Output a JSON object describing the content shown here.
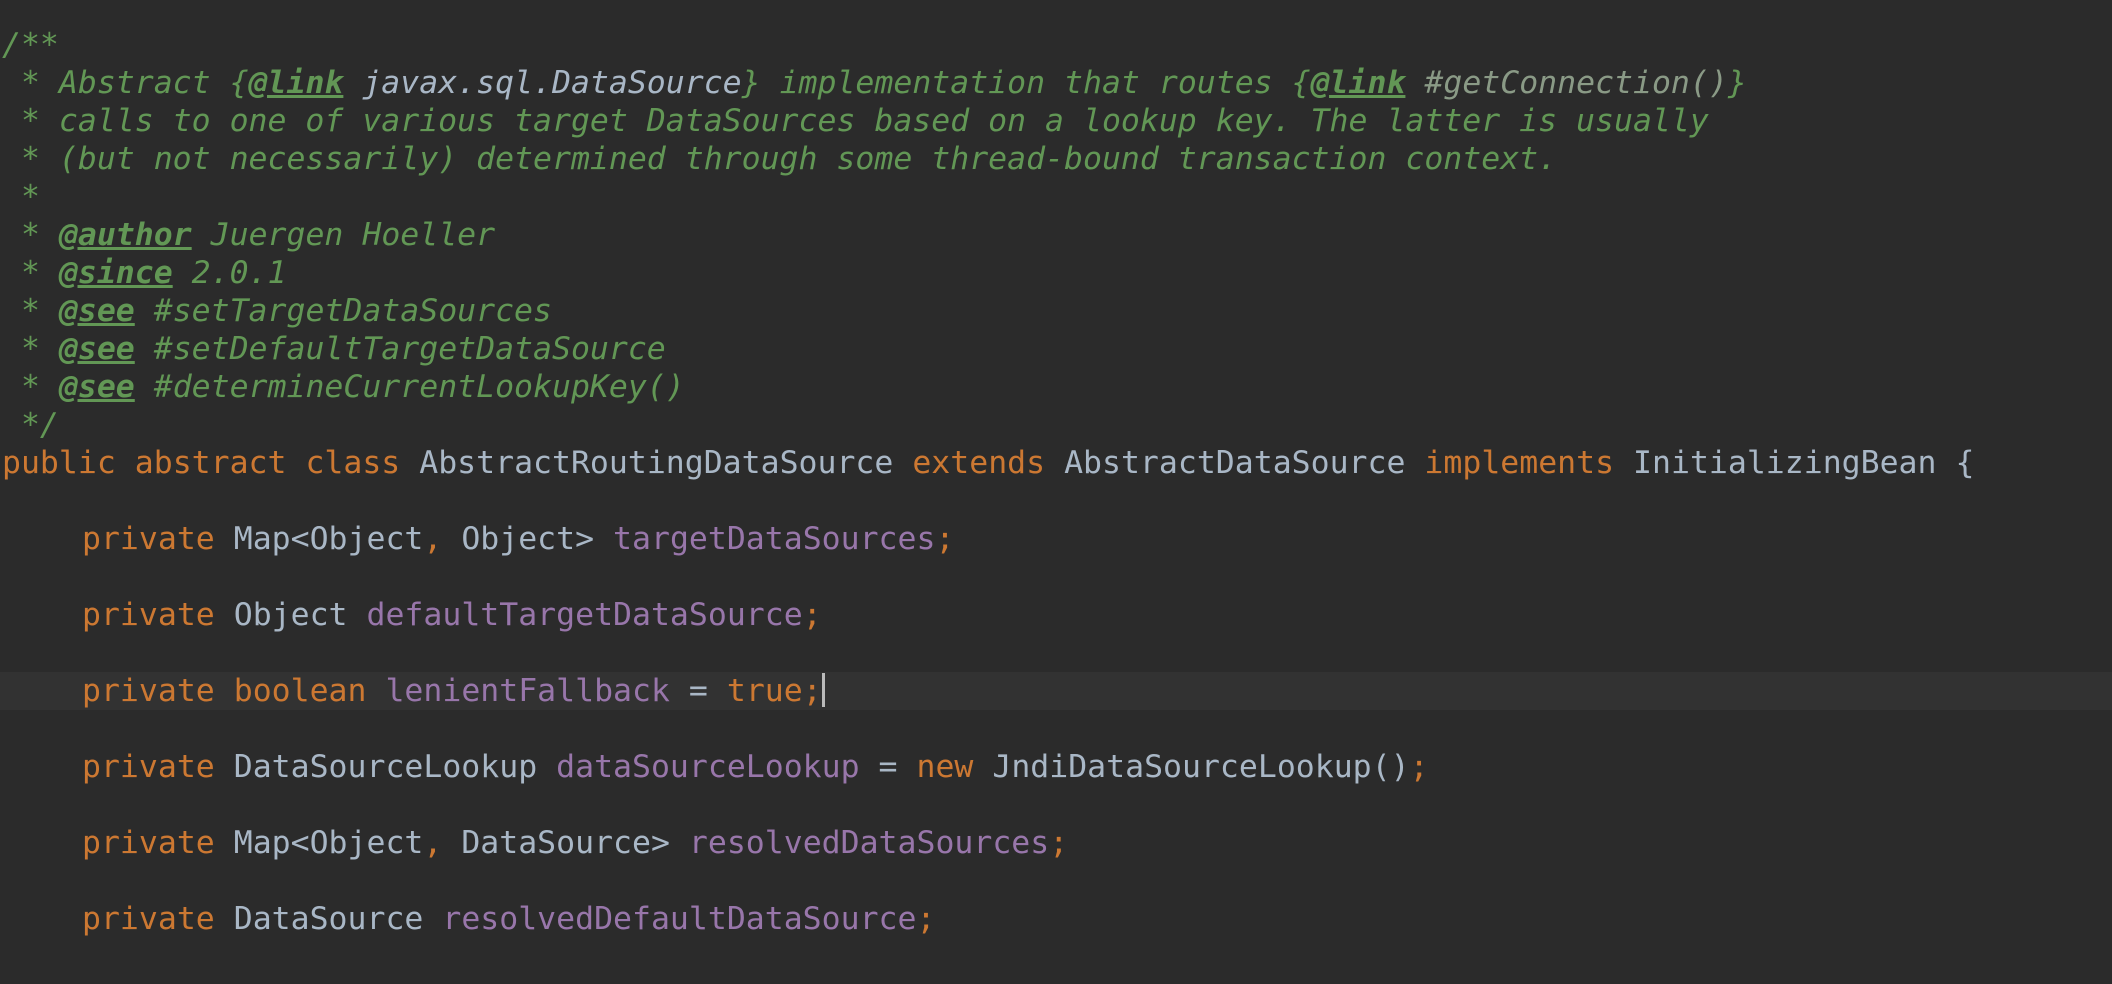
{
  "editor": {
    "language": "java",
    "colors": {
      "background": "#2b2b2b",
      "current_line": "#323232",
      "comment": "#629755",
      "keyword": "#cc7832",
      "identifier": "#a9b7c6",
      "field": "#9876aa"
    },
    "doc": {
      "open": "/**",
      "l1_a": " * Abstract {",
      "l1_link1": "@link",
      "l1_b": " javax.sql.DataSource",
      "l1_c": "} implementation that routes {",
      "l1_link2": "@link",
      "l1_d": " #getConnection()",
      "l1_e": "}",
      "l2": " * calls to one of various target DataSources based on a lookup key. The latter is usually",
      "l3": " * (but not necessarily) determined through some thread-bound transaction context.",
      "l4": " *",
      "star": " * ",
      "author_tag": "@author",
      "author_val": " Juergen Hoeller",
      "since_tag": "@since",
      "since_val": " 2.0.1",
      "see_tag": "@see",
      "see1": " #setTargetDataSources",
      "see2": " #setDefaultTargetDataSource",
      "see3": " #determineCurrentLookupKey()",
      "close": " */"
    },
    "class_decl": {
      "public": "public",
      "abstract": "abstract",
      "class": "class",
      "name": "AbstractRoutingDataSource",
      "extends": "extends",
      "super": "AbstractDataSource",
      "implements": "implements",
      "iface": "InitializingBean",
      "brace": "{"
    },
    "fields": {
      "private": "private",
      "f1_type_a": "Map<Object",
      "comma": ",",
      "f1_type_b": " Object> ",
      "f1_name": "targetDataSources",
      "semi": ";",
      "f2_type": "Object ",
      "f2_name": "defaultTargetDataSource",
      "f3_type": "boolean",
      "f3_name": "lenientFallback",
      "eq": " = ",
      "f3_value": "true",
      "f4_type": "DataSourceLookup ",
      "f4_name": "dataSourceLookup",
      "f4_new": "new",
      "f4_init": " JndiDataSourceLookup()",
      "f5_type_a": "Map<Object",
      "f5_type_b": " DataSource> ",
      "f5_name": "resolvedDataSources",
      "f6_type": "DataSource ",
      "f6_name": "resolvedDefaultDataSource"
    }
  }
}
